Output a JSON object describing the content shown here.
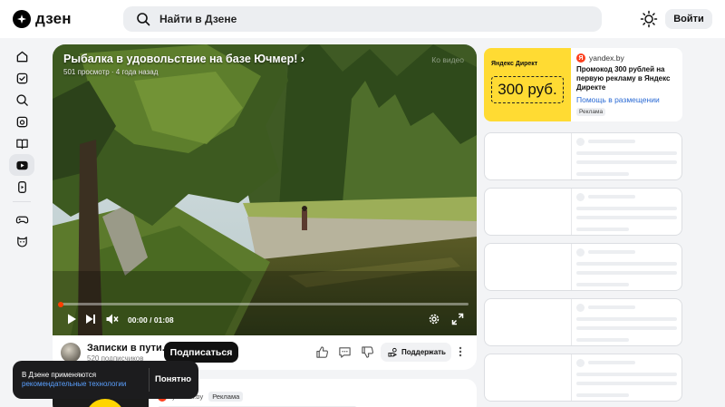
{
  "header": {
    "logo_text": "дзен",
    "search_placeholder": "Найти в Дзене",
    "login_label": "Войти"
  },
  "sidebar": {
    "items": [
      {
        "icon": "home-icon",
        "active": false
      },
      {
        "icon": "subscriptions-icon",
        "active": false
      },
      {
        "icon": "search-icon",
        "active": false
      },
      {
        "icon": "articles-icon",
        "active": false
      },
      {
        "icon": "book-icon",
        "active": false
      },
      {
        "icon": "video-icon",
        "active": true
      },
      {
        "icon": "shorts-icon",
        "active": false
      },
      {
        "icon": "gamepad-icon",
        "active": false
      },
      {
        "icon": "kids-icon",
        "active": false
      }
    ]
  },
  "video": {
    "title": "Рыбалка в удовольствие на базе Ючмер!",
    "meta": "501 просмотр · 4 года назад",
    "watch_label": "Ко видео",
    "time_current": "00:00",
    "time_separator": " / ",
    "time_total": "01:08",
    "progress": 0.0
  },
  "channel": {
    "name": "Записки в пути.",
    "subscribers": "520 подписчиков",
    "subscribe_label": "Подписаться",
    "support_label": "Поддержать"
  },
  "next_card": {
    "source": "yandex.by",
    "tag": "Реклама"
  },
  "toast": {
    "text": "В Дзене применяются",
    "link": "рекомендательные технологии",
    "button": "Понятно"
  },
  "ad": {
    "source": "yandex.by",
    "image_brand": "Яндекс Директ",
    "coupon": "300 руб.",
    "text": "Промокод 300 рублей на первую рекламу в Яндекс Директе",
    "link": "Помощь в размещении",
    "tag": "Реклама"
  },
  "colors": {
    "accent_red": "#ff3d00",
    "ad_yellow": "#ffdb33",
    "link_blue": "#2a6ad4",
    "dark": "#111111"
  }
}
